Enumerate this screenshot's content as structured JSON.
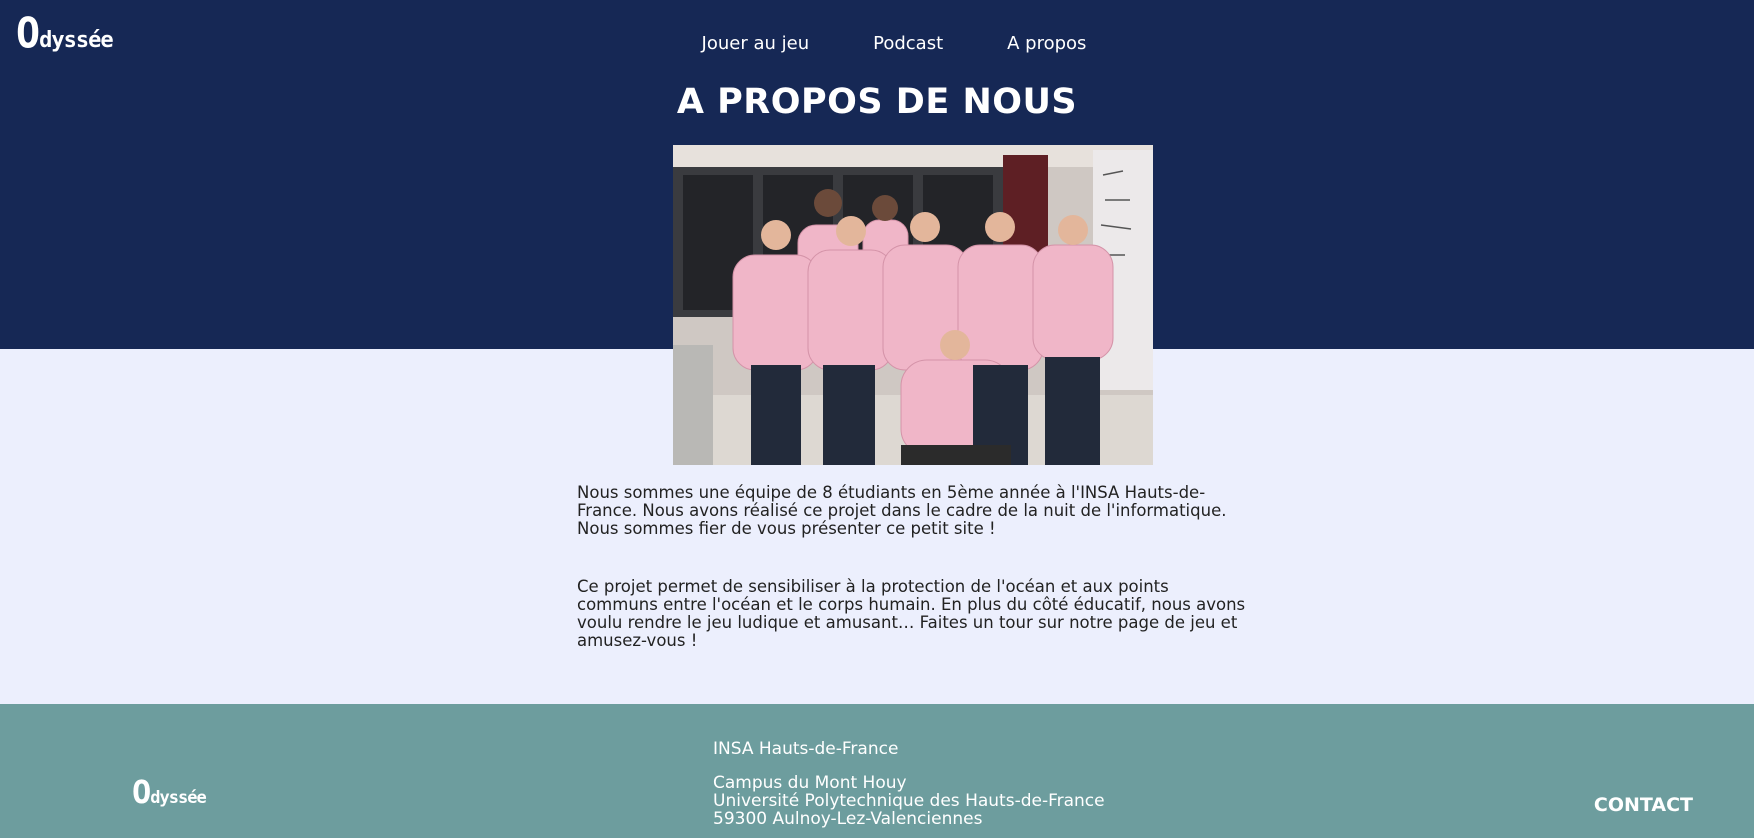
{
  "header": {
    "logo_text": "Odyssée",
    "nav": [
      {
        "label": "Jouer au jeu"
      },
      {
        "label": "Podcast"
      },
      {
        "label": "A propos"
      }
    ]
  },
  "main": {
    "title": "A PROPOS DE NOUS",
    "paragraph_1": "Nous sommes une équipe de 8 étudiants en 5ème année à l'INSA Hauts-de-France. Nous avons réalisé ce projet dans le cadre de la nuit de l'informatique. Nous sommes fier de vous présenter ce petit site !",
    "paragraph_2": "Ce projet permet de sensibiliser à la protection de l'océan et aux points communs entre l'océan et le corps humain. En plus du côté éducatif, nous avons voulu rendre le jeu ludique et amusant… Faites un tour sur notre page de jeu et amusez-vous !"
  },
  "footer": {
    "logo_text": "Odyssée",
    "institution": "INSA Hauts-de-France",
    "address_line_1": "Campus du Mont Houy",
    "address_line_2": "Université Polytechnique des Hauts-de-France",
    "address_line_3": "59300 Aulnoy-Lez-Valenciennes",
    "contact_label": "CONTACT"
  },
  "colors": {
    "header_bg": "#162855",
    "body_bg": "#eceffd",
    "footer_bg": "#6d9d9e",
    "hoodie_pink": "#f0b6c8"
  }
}
